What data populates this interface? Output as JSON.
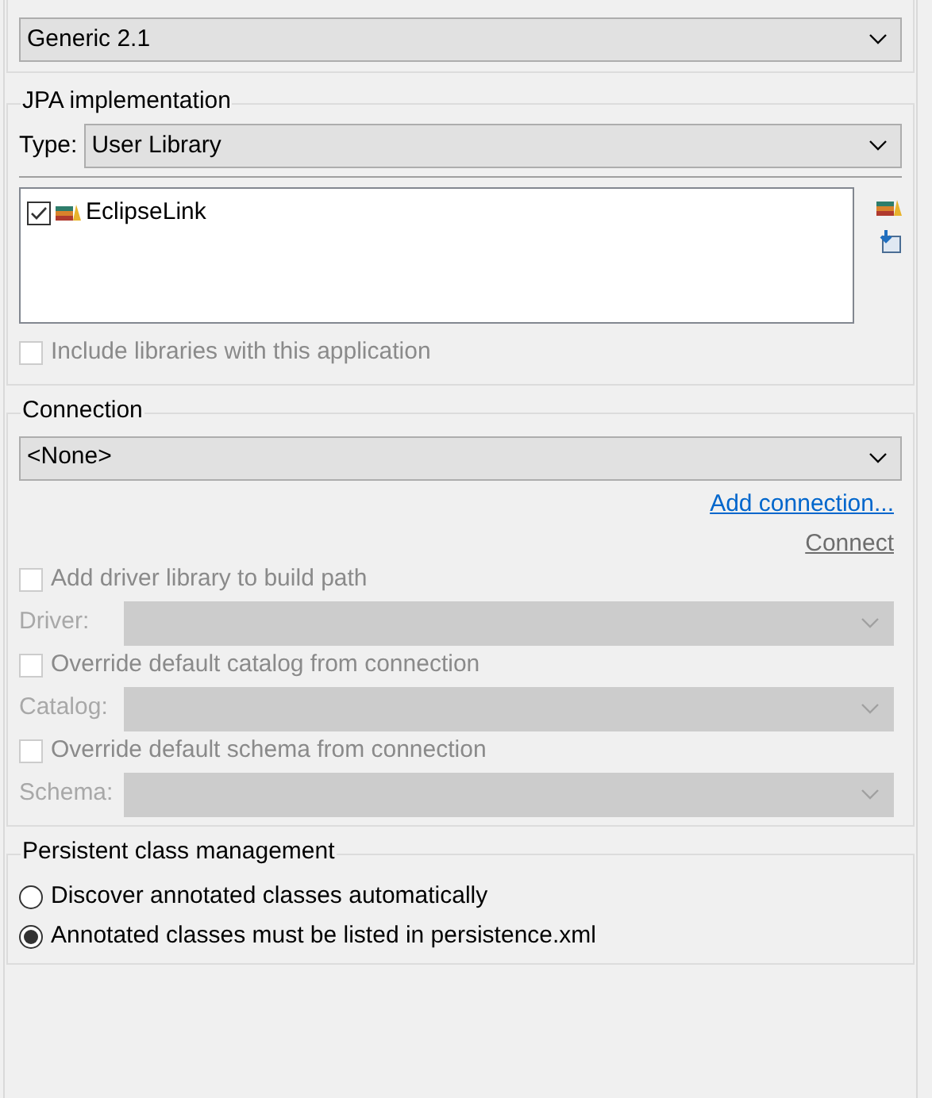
{
  "platform": {
    "value": "Generic 2.1"
  },
  "jpa": {
    "title": "JPA implementation",
    "type_label": "Type:",
    "type_value": "User Library",
    "libraries": [
      {
        "name": "EclipseLink",
        "checked": true
      }
    ],
    "include": {
      "label": "Include libraries with this application",
      "checked": false,
      "disabled": true
    }
  },
  "connection": {
    "title": "Connection",
    "value": "<None>",
    "add_link": "Add connection...",
    "connect_link": "Connect",
    "options": [
      {
        "kind": "checkbox",
        "label": "Add driver library to build path",
        "checked": false,
        "disabled": true
      },
      {
        "kind": "select",
        "label": "Driver:",
        "disabled": true
      },
      {
        "kind": "checkbox",
        "label": "Override default catalog from connection",
        "checked": false,
        "disabled": true
      },
      {
        "kind": "select",
        "label": "Catalog:",
        "disabled": true
      },
      {
        "kind": "checkbox",
        "label": "Override default schema from connection",
        "checked": false,
        "disabled": true
      },
      {
        "kind": "select",
        "label": "Schema:",
        "disabled": true
      }
    ]
  },
  "persistence": {
    "title": "Persistent class management",
    "options": [
      {
        "label": "Discover annotated classes automatically",
        "selected": false
      },
      {
        "label": "Annotated classes must be listed in persistence.xml",
        "selected": true
      }
    ]
  }
}
